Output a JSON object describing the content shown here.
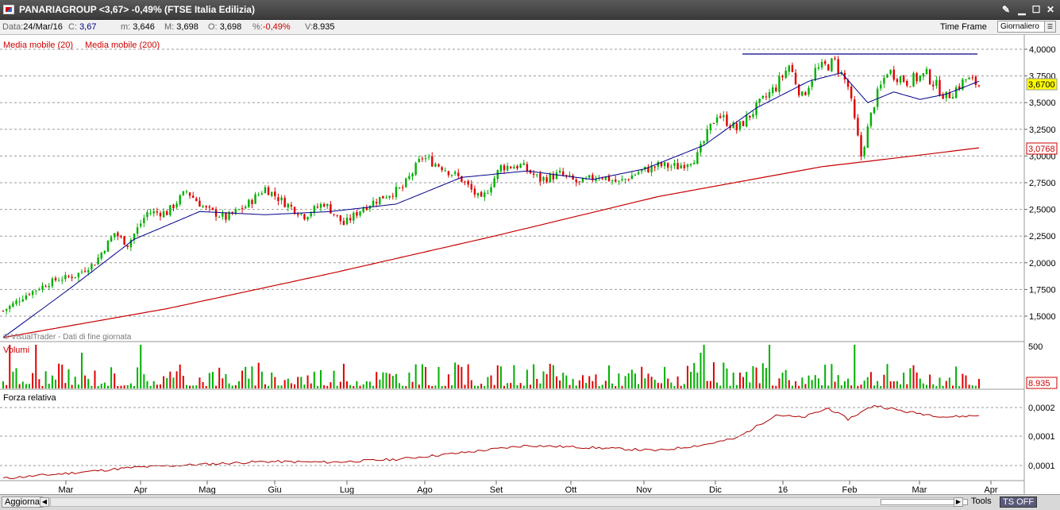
{
  "window": {
    "title": "PANARIAGROUP <3,67>  -0,49%  (FTSE Italia Edilizia)",
    "buttons": [
      "tools-icon",
      "minimize-icon",
      "maximize-icon",
      "close-icon"
    ]
  },
  "info": {
    "data_label": "Data:",
    "data_value": "24/Mar/16",
    "close_label": "C:",
    "close_value": "3,67",
    "min_label": "m:",
    "min_value": "3,646",
    "max_label": "M:",
    "max_value": "3,698",
    "open_label": "O:",
    "open_value": "3,698",
    "pct_label": "%:",
    "pct_value": "-0,49%",
    "vol_label": "V:",
    "vol_value": "8.935",
    "timeframe_label": "Time Frame",
    "timeframe_value": "Giornaliero"
  },
  "legend": {
    "ma20": "Media mobile (20)",
    "ma200": "Media mobile (200)",
    "watermark": "© VisualTrader - Dati di fine giornata",
    "volume_title": "Volumi",
    "rs_title": "Forza relativa"
  },
  "colors": {
    "up": "#00b000",
    "down": "#e00000",
    "ma20": "#00008b",
    "ma200": "#c80000",
    "rs": "#b00000"
  },
  "status": {
    "refresh_label": "Aggiorna",
    "tools_label": "Tools",
    "ts_label": "TS OFF"
  },
  "chart_data": [
    {
      "type": "candlestick",
      "title": "PANARIAGROUP",
      "x_ticks": [
        "Mar",
        "Apr",
        "Mag",
        "Giu",
        "Lug",
        "Ago",
        "Set",
        "Ott",
        "Nov",
        "Dic",
        "16",
        "Feb",
        "Mar",
        "Apr"
      ],
      "y_ticks": [
        "4,0000",
        "3,7500",
        "3,5000",
        "3,2500",
        "3,0000",
        "2,7500",
        "2,5000",
        "2,2500",
        "2,0000",
        "1,7500",
        "1,5000"
      ],
      "ylim": [
        1.25,
        4.05
      ],
      "last_price_label": "3,6700",
      "last_price": 3.67,
      "ma200_label": "3,0768",
      "ma200_last": 3.0768,
      "resistance_levels": [
        3.95
      ],
      "price_path": [
        [
          0,
          1.55
        ],
        [
          8,
          1.72
        ],
        [
          16,
          1.84
        ],
        [
          22,
          1.88
        ],
        [
          28,
          2.0
        ],
        [
          34,
          2.28
        ],
        [
          38,
          2.17
        ],
        [
          44,
          2.47
        ],
        [
          50,
          2.47
        ],
        [
          56,
          2.67
        ],
        [
          62,
          2.5
        ],
        [
          68,
          2.42
        ],
        [
          74,
          2.53
        ],
        [
          80,
          2.7
        ],
        [
          86,
          2.56
        ],
        [
          92,
          2.44
        ],
        [
          98,
          2.56
        ],
        [
          104,
          2.36
        ],
        [
          110,
          2.52
        ],
        [
          116,
          2.62
        ],
        [
          122,
          2.7
        ],
        [
          128,
          2.99
        ],
        [
          134,
          2.9
        ],
        [
          140,
          2.78
        ],
        [
          146,
          2.58
        ],
        [
          152,
          2.9
        ],
        [
          158,
          2.91
        ],
        [
          164,
          2.78
        ],
        [
          170,
          2.83
        ],
        [
          176,
          2.74
        ],
        [
          182,
          2.82
        ],
        [
          188,
          2.75
        ],
        [
          194,
          2.85
        ],
        [
          200,
          2.91
        ],
        [
          206,
          2.9
        ],
        [
          212,
          3.0
        ],
        [
          218,
          3.4
        ],
        [
          224,
          3.25
        ],
        [
          230,
          3.45
        ],
        [
          236,
          3.65
        ],
        [
          240,
          3.85
        ],
        [
          244,
          3.55
        ],
        [
          248,
          3.8
        ],
        [
          254,
          3.88
        ],
        [
          258,
          3.65
        ],
        [
          262,
          3.0
        ],
        [
          266,
          3.5
        ],
        [
          270,
          3.8
        ],
        [
          276,
          3.7
        ],
        [
          282,
          3.76
        ],
        [
          288,
          3.55
        ],
        [
          294,
          3.72
        ],
        [
          298,
          3.67
        ]
      ],
      "ma20_path": [
        [
          0,
          1.3
        ],
        [
          20,
          1.75
        ],
        [
          40,
          2.22
        ],
        [
          60,
          2.48
        ],
        [
          80,
          2.45
        ],
        [
          100,
          2.48
        ],
        [
          120,
          2.55
        ],
        [
          140,
          2.8
        ],
        [
          160,
          2.86
        ],
        [
          180,
          2.78
        ],
        [
          196,
          2.88
        ],
        [
          214,
          3.1
        ],
        [
          230,
          3.45
        ],
        [
          246,
          3.7
        ],
        [
          256,
          3.78
        ],
        [
          264,
          3.5
        ],
        [
          272,
          3.6
        ],
        [
          280,
          3.53
        ],
        [
          288,
          3.58
        ],
        [
          298,
          3.7
        ]
      ],
      "ma200_path": [
        [
          0,
          1.3
        ],
        [
          50,
          1.57
        ],
        [
          100,
          1.9
        ],
        [
          150,
          2.25
        ],
        [
          200,
          2.62
        ],
        [
          250,
          2.9
        ],
        [
          275,
          2.99
        ],
        [
          298,
          3.0768
        ]
      ]
    },
    {
      "type": "bar",
      "title": "Volumi",
      "y_ticks": [
        "500"
      ],
      "last_label": "8.935"
    },
    {
      "type": "line",
      "title": "Forza relativa",
      "y_ticks": [
        "0,0002",
        "0,0001",
        "0,0001"
      ],
      "values_path": [
        [
          0,
          0.2
        ],
        [
          20,
          0.9
        ],
        [
          40,
          1.7
        ],
        [
          60,
          2.1
        ],
        [
          80,
          2.5
        ],
        [
          100,
          2.4
        ],
        [
          120,
          2.8
        ],
        [
          140,
          3.7
        ],
        [
          160,
          4.7
        ],
        [
          180,
          4.4
        ],
        [
          200,
          4.0
        ],
        [
          214,
          4.8
        ],
        [
          224,
          5.7
        ],
        [
          236,
          8.9
        ],
        [
          244,
          8.5
        ],
        [
          252,
          9.8
        ],
        [
          258,
          8.3
        ],
        [
          266,
          10.2
        ],
        [
          276,
          9.3
        ],
        [
          288,
          8.6
        ],
        [
          298,
          8.8
        ]
      ]
    }
  ]
}
